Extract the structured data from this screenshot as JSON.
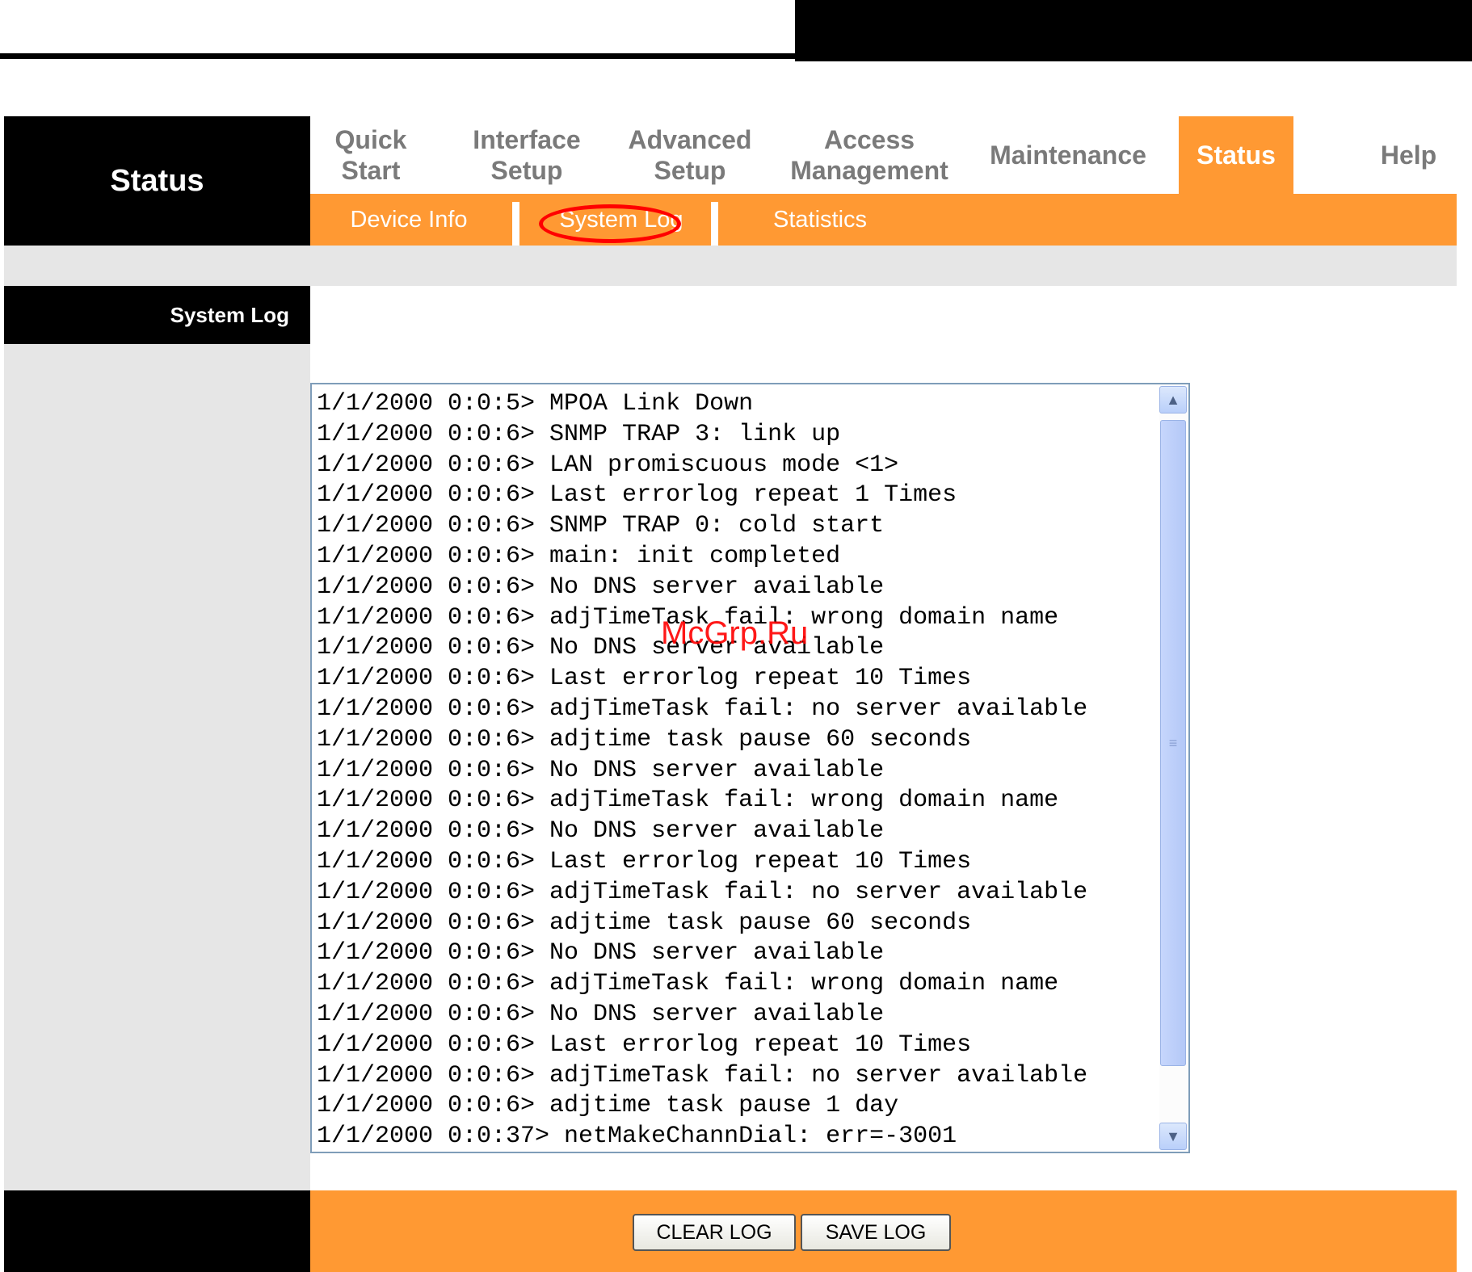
{
  "header": {
    "brand": "Status"
  },
  "nav": [
    {
      "label": "Quick\nStart"
    },
    {
      "label": "Interface\nSetup"
    },
    {
      "label": "Advanced\nSetup"
    },
    {
      "label": "Access\nManagement"
    },
    {
      "label": "Maintenance"
    },
    {
      "label": "Status"
    },
    {
      "label": "Help"
    }
  ],
  "subnav": [
    {
      "label": "Device Info"
    },
    {
      "label": "System Log"
    },
    {
      "label": "Statistics"
    }
  ],
  "section": {
    "title": "System Log"
  },
  "log": {
    "lines": [
      "1/1/2000 0:0:5> MPOA Link Down",
      "1/1/2000 0:0:6> SNMP TRAP 3: link up",
      "1/1/2000 0:0:6> LAN promiscuous mode <1>",
      "1/1/2000 0:0:6> Last errorlog repeat 1 Times",
      "1/1/2000 0:0:6> SNMP TRAP 0: cold start",
      "1/1/2000 0:0:6> main: init completed",
      "1/1/2000 0:0:6> No DNS server available",
      "1/1/2000 0:0:6> adjTimeTask fail: wrong domain name",
      "1/1/2000 0:0:6> No DNS server available",
      "1/1/2000 0:0:6> Last errorlog repeat 10 Times",
      "1/1/2000 0:0:6> adjTimeTask fail: no server available",
      "1/1/2000 0:0:6> adjtime task pause 60 seconds",
      "1/1/2000 0:0:6> No DNS server available",
      "1/1/2000 0:0:6> adjTimeTask fail: wrong domain name",
      "1/1/2000 0:0:6> No DNS server available",
      "1/1/2000 0:0:6> Last errorlog repeat 10 Times",
      "1/1/2000 0:0:6> adjTimeTask fail: no server available",
      "1/1/2000 0:0:6> adjtime task pause 60 seconds",
      "1/1/2000 0:0:6> No DNS server available",
      "1/1/2000 0:0:6> adjTimeTask fail: wrong domain name",
      "1/1/2000 0:0:6> No DNS server available",
      "1/1/2000 0:0:6> Last errorlog repeat 10 Times",
      "1/1/2000 0:0:6> adjTimeTask fail: no server available",
      "1/1/2000 0:0:6> adjtime task pause 1 day",
      "1/1/2000 0:0:37> netMakeChannDial: err=-3001"
    ]
  },
  "watermark": "McGrp.Ru",
  "buttons": {
    "clear": "CLEAR LOG",
    "save": "SAVE LOG"
  },
  "icons": {
    "scroll_up": "scroll-up-icon",
    "scroll_down": "scroll-down-icon",
    "grip": "grip-icon"
  },
  "colors": {
    "accent": "#ff9933",
    "header_bg": "#000000",
    "panel_gray": "#e6e6e6",
    "highlight": "#ff0000"
  }
}
